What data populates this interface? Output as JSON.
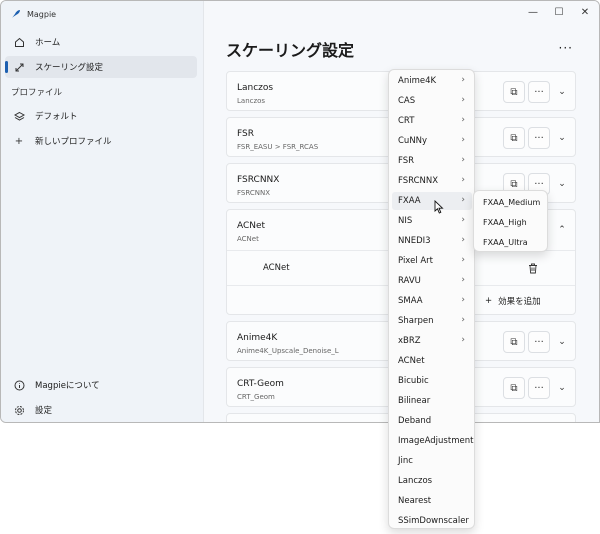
{
  "app": {
    "title": "Magpie"
  },
  "sidebar": {
    "home": "ホーム",
    "scaling": "スケーリング設定",
    "profiles_header": "プロファイル",
    "default": "デフォルト",
    "new_profile": "新しいプロファイル",
    "about": "Magpieについて",
    "settings": "設定"
  },
  "main": {
    "title": "スケーリング設定",
    "more": "···",
    "cards": [
      {
        "title": "Lanczos",
        "sub": "Lanczos"
      },
      {
        "title": "FSR",
        "sub": "FSR_EASU > FSR_RCAS"
      },
      {
        "title": "FSRCNNX",
        "sub": "FSRCNNX"
      },
      {
        "title": "ACNet",
        "sub": "ACNet",
        "effect": "ACNet",
        "add_effect": "効果を追加"
      },
      {
        "title": "Anime4K",
        "sub": "Anime4K_Upscale_Denoise_L"
      },
      {
        "title": "CRT-Geom",
        "sub": "CRT_Geom"
      }
    ]
  },
  "menu": {
    "items": [
      "Anime4K",
      "CAS",
      "CRT",
      "CuNNy",
      "FSR",
      "FSRCNNX",
      "FXAA",
      "NIS",
      "NNEDI3",
      "Pixel Art",
      "RAVU",
      "SMAA",
      "Sharpen",
      "xBRZ",
      "ACNet",
      "Bicubic",
      "Bilinear",
      "Deband",
      "ImageAdjustment",
      "Jinc",
      "Lanczos",
      "Nearest",
      "SSimDownscaler"
    ],
    "submenu_count": 14
  },
  "submenu": {
    "items": [
      "FXAA_Medium",
      "FXAA_High",
      "FXAA_Ultra"
    ]
  },
  "colors": {
    "accent": "#1c5fb0",
    "window_bg": "#f1f4f8",
    "card_bg": "#fbfcfd"
  }
}
